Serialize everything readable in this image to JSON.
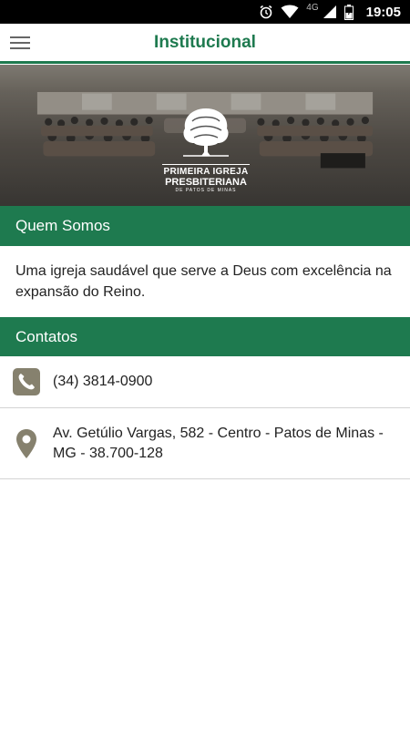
{
  "status_bar": {
    "time": "19:05",
    "network": "4G",
    "icons": [
      "alarm-icon",
      "wifi-icon",
      "cell-signal-icon",
      "battery-icon"
    ]
  },
  "app_bar": {
    "title": "Institucional",
    "menu_icon": "hamburger-menu-icon",
    "accent_color": "#1e7a4f"
  },
  "hero": {
    "logo": {
      "line1": "PRIMEIRA IGREJA",
      "line2": "PRESBITERIANA",
      "line3": "DE PATOS DE MINAS"
    }
  },
  "about": {
    "header": "Quem Somos",
    "text": "Uma igreja saudável que serve a Deus com excelência na expansão do Reino."
  },
  "contacts": {
    "header": "Contatos",
    "phone": {
      "icon": "phone-icon",
      "value": "(34) 3814-0900"
    },
    "address": {
      "icon": "location-pin-icon",
      "value": "Av. Getúlio Vargas, 582 - Centro - Patos de Minas - MG - 38.700-128"
    }
  }
}
